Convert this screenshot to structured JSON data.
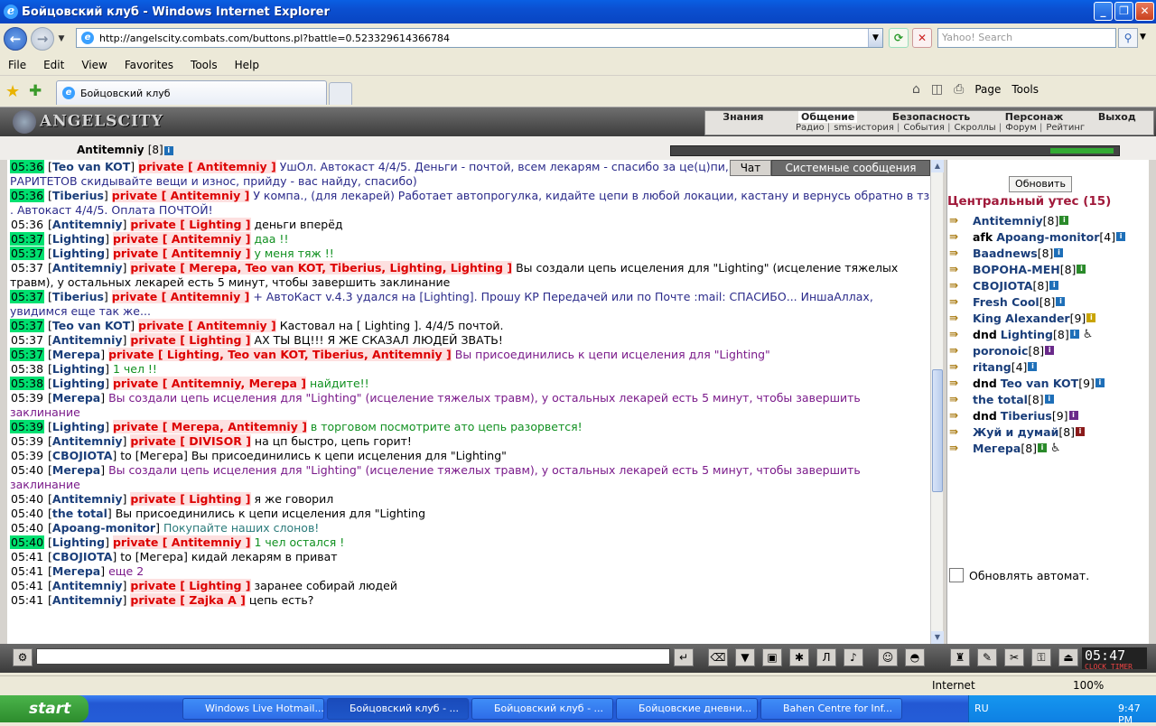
{
  "window": {
    "title": "Бойцовский клуб - Windows Internet Explorer"
  },
  "address": {
    "url": "http://angelscity.combats.com/buttons.pl?battle=0.523329614366784",
    "search_placeholder": "Yahoo! Search"
  },
  "menu": [
    "File",
    "Edit",
    "View",
    "Favorites",
    "Tools",
    "Help"
  ],
  "tab": {
    "label": "Бойцовский клуб"
  },
  "commands": {
    "page": "Page",
    "tools": "Tools"
  },
  "game": {
    "logo": "ANGELSCITY",
    "menu_top": [
      "Знания",
      "Общение",
      "Безопасность",
      "Персонаж",
      "Выход"
    ],
    "menu_bottom": [
      "Радио",
      "sms-история",
      "События",
      "Скроллы",
      "Форум",
      "Рейтинг"
    ],
    "user": {
      "name": "Antitemniy",
      "level": "[8]"
    },
    "chat_tabs": [
      "Чат",
      "Системные сообщения"
    ],
    "refresh_label": "Обновить",
    "location": "Центральный утес (15)",
    "auto_refresh": "Обновлять автомат.",
    "clock": "05:47",
    "clock_sub": "CLOCK TIMER"
  },
  "chat": [
    {
      "time": "05:36",
      "hl": true,
      "nick": "Teo van KOT",
      "priv": "private [ Antitemniy ]",
      "text": "УшОл. Автокаст 4/4/5. Деньги - почтой, всем лекарям - спасибо за це(ц)пи, (пришел на счет скупки РАРИТЕТОВ скидывайте вещи и износ, прийду - вас найду, спасибо)",
      "cls": "navy"
    },
    {
      "time": "05:36",
      "hl": true,
      "nick": "Tiberius",
      "priv": "private [ Antitemniy ]",
      "text": "У компа., (для лекарей) Работает автопрогулка, кидайте цепи в любой локации, кастану и вернусь обратно в тз . Автокаст 4/4/5.    Оплата ПОЧТОЙ!",
      "cls": "navy"
    },
    {
      "time": "05:36",
      "hl": false,
      "nick": "Antitemniy",
      "priv": "private [ Lighting ]",
      "text": "деньги вперёд",
      "cls": ""
    },
    {
      "time": "05:37",
      "hl": true,
      "nick": "Lighting",
      "priv": "private [ Antitemniy ]",
      "text": "даа !!",
      "cls": "green"
    },
    {
      "time": "05:37",
      "hl": true,
      "nick": "Lighting",
      "priv": "private [ Antitemniy ]",
      "text": "у меня тяж !!",
      "cls": "green"
    },
    {
      "time": "05:37",
      "hl": false,
      "nick": "Antitemniy",
      "priv": "private [ Мегера, Teo van KOT, Tiberius, Lighting, Lighting ]",
      "text": "Вы создали цепь исцеления для \"Lighting\" (исцеление тяжелых травм), у остальных лекарей есть 5 минут, чтобы завершить заклинание",
      "cls": ""
    },
    {
      "time": "05:37",
      "hl": true,
      "nick": "Tiberius",
      "priv": "private [ Antitemniy ]",
      "text": "+ АвтоКаст v.4.3 удался на [Lighting]. Прошу КР Передачей или по Почте :mail: СПАСИБО... ИншаАллах, увидимся еще так же...",
      "cls": "navy"
    },
    {
      "time": "05:37",
      "hl": true,
      "nick": "Teo van KOT",
      "priv": "private [ Antitemniy ]",
      "text": "Кастовал на [ Lighting ]. 4/4/5 почтой.",
      "cls": ""
    },
    {
      "time": "05:37",
      "hl": false,
      "nick": "Antitemniy",
      "priv": "private [ Lighting ]",
      "text": "АХ ТЫ ВЦ!!! Я ЖЕ СКАЗАЛ ЛЮДЕЙ ЗВАТЬ!",
      "cls": ""
    },
    {
      "time": "05:37",
      "hl": true,
      "nick": "Мегера",
      "priv": "private [ Lighting, Teo van KOT, Tiberius, Antitemniy ]",
      "text": "Вы присоединились к цепи исцеления для \"Lighting\"",
      "cls": "purple"
    },
    {
      "time": "05:38",
      "hl": false,
      "nick": "Lighting",
      "priv": "",
      "text": "1 чел !!",
      "cls": "green"
    },
    {
      "time": "05:38",
      "hl": true,
      "nick": "Lighting",
      "priv": "private [ Antitemniy, Мегера ]",
      "text": "найдите!!",
      "cls": "green"
    },
    {
      "time": "05:39",
      "hl": false,
      "nick": "Мегера",
      "priv": "",
      "text": "Вы создали цепь исцеления для \"Lighting\" (исцеление тяжелых травм), у остальных лекарей есть 5 минут, чтобы завершить заклинание",
      "cls": "purple"
    },
    {
      "time": "05:39",
      "hl": true,
      "nick": "Lighting",
      "priv": "private [ Мегера, Antitemniy ]",
      "text": "в торговом посмотрите ато цепь разорвется!",
      "cls": "green"
    },
    {
      "time": "05:39",
      "hl": false,
      "nick": "Antitemniy",
      "priv": "private [ DIVISOR ]",
      "text": "на цп быстро, цепь горит!",
      "cls": ""
    },
    {
      "time": "05:39",
      "hl": false,
      "nick": "СВОЈIOTA",
      "priv": "",
      "text": "to [Мегера] Вы присоединились к цепи исцеления для \"Lighting\"",
      "cls": ""
    },
    {
      "time": "05:40",
      "hl": false,
      "nick": "Мегера",
      "priv": "",
      "text": "Вы создали цепь исцеления для \"Lighting\" (исцеление тяжелых травм), у остальных лекарей есть 5 минут, чтобы завершить заклинание",
      "cls": "purple"
    },
    {
      "time": "05:40",
      "hl": false,
      "nick": "Antitemniy",
      "priv": "private [ Lighting ]",
      "text": "я же говорил",
      "cls": ""
    },
    {
      "time": "05:40",
      "hl": false,
      "nick": "the total",
      "priv": "",
      "text": "Вы присоединились к цепи исцеления для \"Lighting",
      "cls": ""
    },
    {
      "time": "05:40",
      "hl": false,
      "nick": "Apoang-monitor",
      "priv": "",
      "text": "Покупайте наших слонов!",
      "cls": "teal"
    },
    {
      "time": "05:40",
      "hl": true,
      "nick": "Lighting",
      "priv": "private [ Antitemniy ]",
      "text": "1 чел остался !",
      "cls": "green"
    },
    {
      "time": "05:41",
      "hl": false,
      "nick": "СВОЈIOTA",
      "priv": "",
      "text": "to [Мегера] кидай лекарям в приват",
      "cls": ""
    },
    {
      "time": "05:41",
      "hl": false,
      "nick": "Мегера",
      "priv": "",
      "text": "еще 2",
      "cls": "purple"
    },
    {
      "time": "05:41",
      "hl": false,
      "nick": "Antitemniy",
      "priv": "private [ Lighting ]",
      "text": "заранее собирай людей",
      "cls": ""
    },
    {
      "time": "05:41",
      "hl": false,
      "nick": "Antitemniy",
      "priv": "private [ Zajka A ]",
      "text": "цепь есть?",
      "cls": ""
    }
  ],
  "users": [
    {
      "pre": "",
      "name": "Antitemniy",
      "lvl": "[8]",
      "info": "g",
      "extra": ""
    },
    {
      "pre": "afk",
      "name": "Apoang-monitor",
      "lvl": "[4]",
      "info": "",
      "extra": ""
    },
    {
      "pre": "",
      "name": "Baadnews",
      "lvl": "[8]",
      "info": "",
      "extra": ""
    },
    {
      "pre": "",
      "name": "ВОРОНА-МЕН",
      "lvl": "[8]",
      "info": "g",
      "extra": ""
    },
    {
      "pre": "",
      "name": "СВОЈIOTA",
      "lvl": "[8]",
      "info": "",
      "extra": ""
    },
    {
      "pre": "",
      "name": "Fresh Cool",
      "lvl": "[8]",
      "info": "",
      "extra": ""
    },
    {
      "pre": "",
      "name": "King Alexander",
      "lvl": "[9]",
      "info": "y",
      "extra": ""
    },
    {
      "pre": "dnd",
      "name": "Lighting",
      "lvl": "[8]",
      "info": "",
      "extra": "♿"
    },
    {
      "pre": "",
      "name": "poronoic",
      "lvl": "[8]",
      "info": "p",
      "extra": ""
    },
    {
      "pre": "",
      "name": "ritang",
      "lvl": "[4]",
      "info": "",
      "extra": ""
    },
    {
      "pre": "dnd",
      "name": "Teo van KOT",
      "lvl": "[9]",
      "info": "",
      "extra": ""
    },
    {
      "pre": "",
      "name": "the total",
      "lvl": "[8]",
      "info": "",
      "extra": ""
    },
    {
      "pre": "dnd",
      "name": "Tiberius",
      "lvl": "[9]",
      "info": "p",
      "extra": ""
    },
    {
      "pre": "",
      "name": "Жуй и думай",
      "lvl": "[8]",
      "info": "r",
      "extra": ""
    },
    {
      "pre": "",
      "name": "Мегера",
      "lvl": "[8]",
      "info": "g",
      "extra": "♿"
    }
  ],
  "status": {
    "zone": "Internet",
    "zoom": "100%"
  },
  "taskbar": {
    "start": "start",
    "tasks": [
      "Windows Live Hotmail...",
      "Бойцовский клуб - ...",
      "Бойцовский клуб - ...",
      "Бойцовские дневни...",
      "Bahen Centre for Inf..."
    ],
    "lang": "RU",
    "time": "9:47 PM"
  }
}
